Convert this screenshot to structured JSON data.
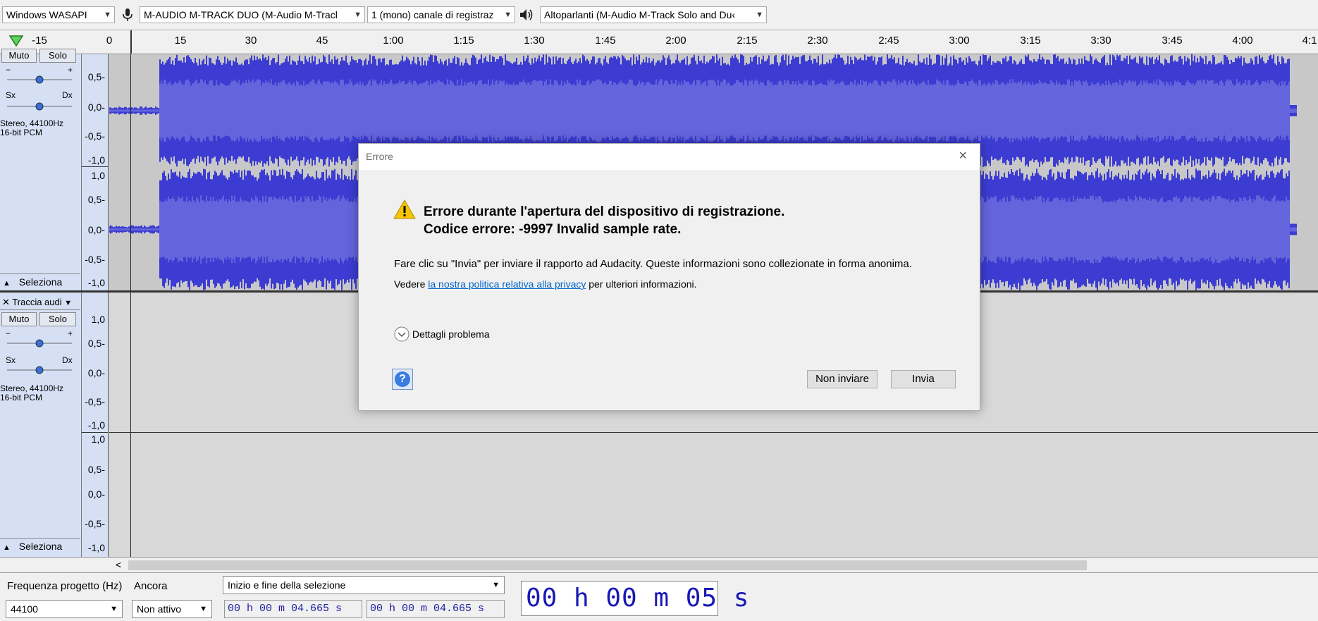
{
  "device_toolbar": {
    "host": "Windows WASAPI",
    "recording_device": "M-AUDIO M-TRACK DUO (M-Audio M-Tracl",
    "channels": "1 (mono) canale di registraz",
    "playback_device": "Altoparlanti (M-Audio M-Track Solo and Du‹"
  },
  "ruler": {
    "ticks": [
      "-15",
      "0",
      "15",
      "30",
      "45",
      "1:00",
      "1:15",
      "1:30",
      "1:45",
      "2:00",
      "2:15",
      "2:30",
      "2:45",
      "3:00",
      "3:15",
      "3:30",
      "3:45",
      "4:00",
      "4:1"
    ]
  },
  "track1": {
    "mute": "Muto",
    "solo": "Solo",
    "gain_minus": "−",
    "gain_plus": "+",
    "pan_left": "Sx",
    "pan_right": "Dx",
    "info_line1": "Stereo, 44100Hz",
    "info_line2": "16-bit PCM",
    "select": "Seleziona",
    "scale_top": [
      "0,5-",
      "0,0-",
      "-0,5-",
      "-1,0"
    ],
    "scale_bottom": [
      "1,0",
      "0,5-",
      "0,0-",
      "-0,5-",
      "-1,0"
    ]
  },
  "track2": {
    "name": "Traccia audi",
    "mute": "Muto",
    "solo": "Solo",
    "gain_minus": "−",
    "gain_plus": "+",
    "pan_left": "Sx",
    "pan_right": "Dx",
    "info_line1": "Stereo, 44100Hz",
    "info_line2": "16-bit PCM",
    "select": "Seleziona",
    "scale_top": [
      "1,0",
      "0,5-",
      "0,0-",
      "-0,5-",
      "-1,0"
    ],
    "scale_bottom": [
      "1,0",
      "0,5-",
      "0,0-",
      "-0,5-",
      "-1,0"
    ]
  },
  "selection_toolbar": {
    "rate_label": "Frequenza progetto (Hz)",
    "rate_value": "44100",
    "snap_label": "Ancora",
    "snap_value": "Non attivo",
    "selection_mode": "Inizio e fine della selezione",
    "sel_start": "00 h 00 m 04.665 s",
    "sel_end": "00 h 00 m 04.665 s",
    "audio_position": "00 h 00 m 05 s"
  },
  "dialog": {
    "title": "Errore",
    "close": "×",
    "headline1": "Errore durante l'apertura del dispositivo di registrazione.",
    "headline2": "Codice errore: -9997 Invalid sample rate.",
    "body": "Fare clic su \"Invia\" per inviare il rapporto ad Audacity. Queste informazioni sono collezionate in forma anonima.",
    "privacy_prefix": "Vedere",
    "privacy_link": "la nostra politica relativa alla privacy",
    "privacy_suffix": "per ulteriori informazioni.",
    "details": "Dettagli problema",
    "help": "?",
    "dont_send": "Non inviare",
    "send": "Invia"
  },
  "colors": {
    "waveform": "#3c3cd2",
    "waveform_rms": "#6464dc",
    "track_panel": "#d6e0f5",
    "link": "#0066cc",
    "time_digits": "#1818b8"
  }
}
